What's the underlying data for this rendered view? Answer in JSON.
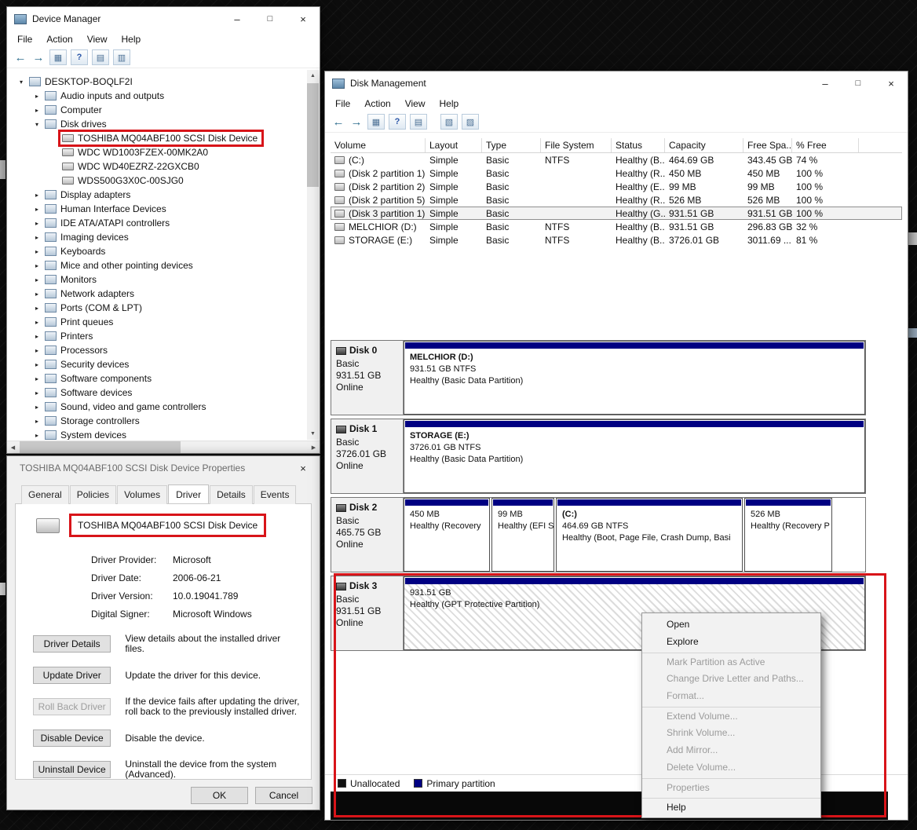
{
  "window_chrome": {
    "minimize": "–",
    "maximize": "□",
    "close": "×"
  },
  "device_manager": {
    "title": "Device Manager",
    "menu": [
      "File",
      "Action",
      "View",
      "Help"
    ],
    "toolbar": [
      {
        "name": "back-icon",
        "glyph": "←",
        "cls": "nav"
      },
      {
        "name": "forward-icon",
        "glyph": "→",
        "cls": "nav"
      },
      {
        "name": "console-tree-icon",
        "glyph": "▦",
        "cls": "tool"
      },
      {
        "name": "help-icon",
        "glyph": "?",
        "cls": "tool help"
      },
      {
        "name": "properties-icon",
        "glyph": "▤",
        "cls": "tool"
      },
      {
        "name": "scan-hardware-icon",
        "glyph": "▥",
        "cls": "tool"
      }
    ],
    "tree": [
      {
        "expander": "▾",
        "label": "DESKTOP-BOQLF2I",
        "cls": "lvl0"
      },
      {
        "expander": "▸",
        "label": "Audio inputs and outputs",
        "cls": "lvl1"
      },
      {
        "expander": "▸",
        "label": "Computer",
        "cls": "lvl1"
      },
      {
        "expander": "▾",
        "label": "Disk drives",
        "cls": "lvl1"
      },
      {
        "expander": "",
        "label": "TOSHIBA MQ04ABF100 SCSI Disk Device",
        "cls": "lvl2 boxed"
      },
      {
        "expander": "",
        "label": "WDC WD1003FZEX-00MK2A0",
        "cls": "lvl2"
      },
      {
        "expander": "",
        "label": "WDC WD40EZRZ-22GXCB0",
        "cls": "lvl2"
      },
      {
        "expander": "",
        "label": "WDS500G3X0C-00SJG0",
        "cls": "lvl2"
      },
      {
        "expander": "▸",
        "label": "Display adapters",
        "cls": "lvl1"
      },
      {
        "expander": "▸",
        "label": "Human Interface Devices",
        "cls": "lvl1"
      },
      {
        "expander": "▸",
        "label": "IDE ATA/ATAPI controllers",
        "cls": "lvl1"
      },
      {
        "expander": "▸",
        "label": "Imaging devices",
        "cls": "lvl1"
      },
      {
        "expander": "▸",
        "label": "Keyboards",
        "cls": "lvl1"
      },
      {
        "expander": "▸",
        "label": "Mice and other pointing devices",
        "cls": "lvl1"
      },
      {
        "expander": "▸",
        "label": "Monitors",
        "cls": "lvl1"
      },
      {
        "expander": "▸",
        "label": "Network adapters",
        "cls": "lvl1"
      },
      {
        "expander": "▸",
        "label": "Ports (COM & LPT)",
        "cls": "lvl1"
      },
      {
        "expander": "▸",
        "label": "Print queues",
        "cls": "lvl1"
      },
      {
        "expander": "▸",
        "label": "Printers",
        "cls": "lvl1"
      },
      {
        "expander": "▸",
        "label": "Processors",
        "cls": "lvl1"
      },
      {
        "expander": "▸",
        "label": "Security devices",
        "cls": "lvl1"
      },
      {
        "expander": "▸",
        "label": "Software components",
        "cls": "lvl1"
      },
      {
        "expander": "▸",
        "label": "Software devices",
        "cls": "lvl1"
      },
      {
        "expander": "▸",
        "label": "Sound, video and game controllers",
        "cls": "lvl1"
      },
      {
        "expander": "▸",
        "label": "Storage controllers",
        "cls": "lvl1"
      },
      {
        "expander": "▸",
        "label": "System devices",
        "cls": "lvl1"
      }
    ]
  },
  "disk_management": {
    "title": "Disk Management",
    "menu": [
      "File",
      "Action",
      "View",
      "Help"
    ],
    "toolbar": [
      {
        "name": "back-icon",
        "glyph": "←",
        "cls": "nav"
      },
      {
        "name": "forward-icon",
        "glyph": "→",
        "cls": "nav"
      },
      {
        "name": "console-tree-icon",
        "glyph": "▦",
        "cls": "tool"
      },
      {
        "name": "help-icon",
        "glyph": "?",
        "cls": "tool help"
      },
      {
        "name": "action-pane-icon",
        "glyph": "▤",
        "cls": "tool"
      },
      {
        "name": "refresh-icon",
        "glyph": "▧",
        "cls": "tool gap"
      },
      {
        "name": "layout-icon",
        "glyph": "▨",
        "cls": "tool"
      }
    ],
    "table": {
      "columns": [
        "Volume",
        "Layout",
        "Type",
        "File System",
        "Status",
        "Capacity",
        "Free Spa...",
        "% Free"
      ],
      "rows": [
        {
          "c": [
            "(C:)",
            "Simple",
            "Basic",
            "NTFS",
            "Healthy (B...",
            "464.69 GB",
            "343.45 GB",
            "74 %"
          ]
        },
        {
          "c": [
            "(Disk 2 partition 1)",
            "Simple",
            "Basic",
            "",
            "Healthy (R...",
            "450 MB",
            "450 MB",
            "100 %"
          ]
        },
        {
          "c": [
            "(Disk 2 partition 2)",
            "Simple",
            "Basic",
            "",
            "Healthy (E...",
            "99 MB",
            "99 MB",
            "100 %"
          ]
        },
        {
          "c": [
            "(Disk 2 partition 5)",
            "Simple",
            "Basic",
            "",
            "Healthy (R...",
            "526 MB",
            "526 MB",
            "100 %"
          ]
        },
        {
          "c": [
            "(Disk 3 partition 1)",
            "Simple",
            "Basic",
            "",
            "Healthy (G...",
            "931.51 GB",
            "931.51 GB",
            "100 %"
          ],
          "cls": "selected"
        },
        {
          "c": [
            "MELCHIOR (D:)",
            "Simple",
            "Basic",
            "NTFS",
            "Healthy (B...",
            "931.51 GB",
            "296.83 GB",
            "32 %"
          ]
        },
        {
          "c": [
            "STORAGE (E:)",
            "Simple",
            "Basic",
            "NTFS",
            "Healthy (B...",
            "3726.01 GB",
            "3011.69 ...",
            "81 %"
          ]
        }
      ]
    },
    "disks": [
      {
        "name": "Disk 0",
        "type": "Basic",
        "size": "931.51 GB",
        "status": "Online",
        "partitions": [
          {
            "name": "MELCHIOR (D:)",
            "size": "931.51 GB NTFS",
            "status": "Healthy (Basic Data Partition)"
          }
        ]
      },
      {
        "name": "Disk 1",
        "type": "Basic",
        "size": "3726.01 GB",
        "status": "Online",
        "partitions": [
          {
            "name": "STORAGE (E:)",
            "size": "3726.01 GB NTFS",
            "status": "Healthy (Basic Data Partition)"
          }
        ]
      },
      {
        "name": "Disk 2",
        "type": "Basic",
        "size": "465.75 GB",
        "status": "Online",
        "partitions": [
          {
            "size": "450 MB",
            "status": "Healthy (Recovery"
          },
          {
            "size": "99 MB",
            "status": "Healthy (EFI S"
          },
          {
            "name": "(C:)",
            "size": "464.69 GB NTFS",
            "status": "Healthy (Boot, Page File, Crash Dump, Basi"
          },
          {
            "size": "526 MB",
            "status": "Healthy (Recovery P"
          }
        ]
      },
      {
        "name": "Disk 3",
        "type": "Basic",
        "size": "931.51 GB",
        "status": "Online",
        "partitions": [
          {
            "size": "931.51 GB",
            "status": "Healthy (GPT Protective Partition)"
          }
        ]
      }
    ],
    "legend": {
      "unallocated": "Unallocated",
      "primary": "Primary partition"
    },
    "context_menu": {
      "items": [
        {
          "label": "Open"
        },
        {
          "label": "Explore"
        },
        {
          "label": "Mark Partition as Active",
          "cls": "disabled sep-above"
        },
        {
          "label": "Change Drive Letter and Paths...",
          "cls": "disabled"
        },
        {
          "label": "Format...",
          "cls": "disabled"
        },
        {
          "label": "Extend Volume...",
          "cls": "disabled sep-above"
        },
        {
          "label": "Shrink Volume...",
          "cls": "disabled"
        },
        {
          "label": "Add Mirror...",
          "cls": "disabled"
        },
        {
          "label": "Delete Volume...",
          "cls": "disabled"
        },
        {
          "label": "Properties",
          "cls": "disabled sep-above"
        },
        {
          "label": "Help",
          "cls": "sep-above"
        }
      ]
    }
  },
  "properties_dialog": {
    "title": "TOSHIBA MQ04ABF100 SCSI Disk Device Properties",
    "tabs": [
      {
        "label": "General"
      },
      {
        "label": "Policies"
      },
      {
        "label": "Volumes"
      },
      {
        "label": "Driver",
        "cls": "active"
      },
      {
        "label": "Details"
      },
      {
        "label": "Events"
      }
    ],
    "device_name": "TOSHIBA MQ04ABF100 SCSI Disk Device",
    "fields": [
      {
        "label": "Driver Provider:",
        "value": "Microsoft"
      },
      {
        "label": "Driver Date:",
        "value": "2006-06-21"
      },
      {
        "label": "Driver Version:",
        "value": "10.0.19041.789"
      },
      {
        "label": "Digital Signer:",
        "value": "Microsoft Windows"
      }
    ],
    "actions": [
      {
        "button": "Driver Details",
        "desc": "View details about the installed driver files."
      },
      {
        "button": "Update Driver",
        "desc": "Update the driver for this device."
      },
      {
        "button": "Roll Back Driver",
        "desc": "If the device fails after updating the driver, roll back to the previously installed driver.",
        "cls": "disabled"
      },
      {
        "button": "Disable Device",
        "desc": "Disable the device."
      },
      {
        "button": "Uninstall Device",
        "desc": "Uninstall the device from the system (Advanced)."
      }
    ],
    "ok": "OK",
    "cancel": "Cancel"
  }
}
